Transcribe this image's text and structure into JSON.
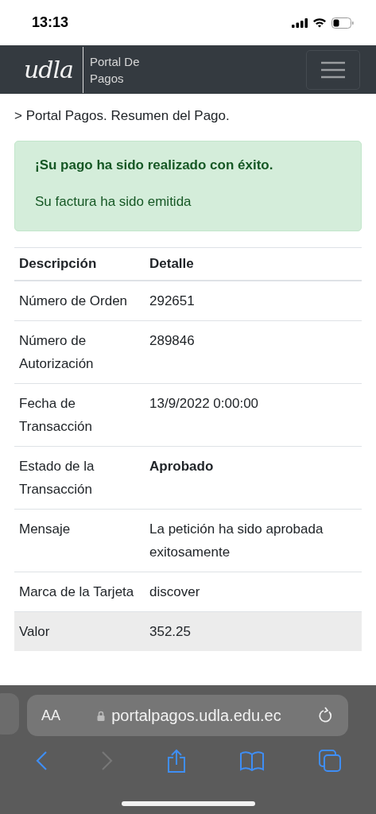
{
  "status_bar": {
    "time": "13:13"
  },
  "navbar": {
    "logo": "udla",
    "title": "Portal De Pagos"
  },
  "breadcrumb": "> Portal Pagos. Resumen del Pago.",
  "alert": {
    "heading": "¡Su pago ha sido realizado con éxito.",
    "message": "Su factura ha sido emitida"
  },
  "table": {
    "columns": [
      "Descripción",
      "Detalle"
    ],
    "rows": [
      {
        "label": "Número de Orden",
        "value": "292651",
        "bold": false,
        "highlighted": false
      },
      {
        "label": "Número de Autorización",
        "value": "289846",
        "bold": false,
        "highlighted": false
      },
      {
        "label": "Fecha de Transacción",
        "value": "13/9/2022 0:00:00",
        "bold": false,
        "highlighted": false
      },
      {
        "label": "Estado de la Transacción",
        "value": "Aprobado",
        "bold": true,
        "highlighted": false
      },
      {
        "label": "Mensaje",
        "value": "La petición ha sido aprobada exitosamente",
        "bold": false,
        "highlighted": false
      },
      {
        "label": "Marca de la Tarjeta",
        "value": "discover",
        "bold": false,
        "highlighted": false
      },
      {
        "label": "Valor",
        "value": "352.25",
        "bold": false,
        "highlighted": true
      }
    ]
  },
  "browser": {
    "text_size": "AA",
    "url": "portalpagos.udla.edu.ec",
    "toolbar": [
      {
        "kind": "back",
        "disabled": false
      },
      {
        "kind": "forward",
        "disabled": true
      },
      {
        "kind": "share",
        "disabled": false
      },
      {
        "kind": "bookmarks",
        "disabled": false
      },
      {
        "kind": "tabs",
        "disabled": false
      }
    ]
  }
}
